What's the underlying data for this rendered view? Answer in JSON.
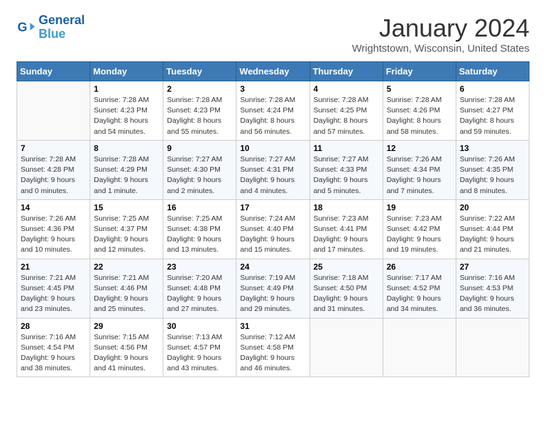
{
  "header": {
    "logo_line1": "General",
    "logo_line2": "Blue",
    "month_title": "January 2024",
    "location": "Wrightstown, Wisconsin, United States"
  },
  "days_of_week": [
    "Sunday",
    "Monday",
    "Tuesday",
    "Wednesday",
    "Thursday",
    "Friday",
    "Saturday"
  ],
  "weeks": [
    [
      {
        "day": "",
        "info": ""
      },
      {
        "day": "1",
        "info": "Sunrise: 7:28 AM\nSunset: 4:23 PM\nDaylight: 8 hours\nand 54 minutes."
      },
      {
        "day": "2",
        "info": "Sunrise: 7:28 AM\nSunset: 4:23 PM\nDaylight: 8 hours\nand 55 minutes."
      },
      {
        "day": "3",
        "info": "Sunrise: 7:28 AM\nSunset: 4:24 PM\nDaylight: 8 hours\nand 56 minutes."
      },
      {
        "day": "4",
        "info": "Sunrise: 7:28 AM\nSunset: 4:25 PM\nDaylight: 8 hours\nand 57 minutes."
      },
      {
        "day": "5",
        "info": "Sunrise: 7:28 AM\nSunset: 4:26 PM\nDaylight: 8 hours\nand 58 minutes."
      },
      {
        "day": "6",
        "info": "Sunrise: 7:28 AM\nSunset: 4:27 PM\nDaylight: 8 hours\nand 59 minutes."
      }
    ],
    [
      {
        "day": "7",
        "info": "Sunrise: 7:28 AM\nSunset: 4:28 PM\nDaylight: 9 hours\nand 0 minutes."
      },
      {
        "day": "8",
        "info": "Sunrise: 7:28 AM\nSunset: 4:29 PM\nDaylight: 9 hours\nand 1 minute."
      },
      {
        "day": "9",
        "info": "Sunrise: 7:27 AM\nSunset: 4:30 PM\nDaylight: 9 hours\nand 2 minutes."
      },
      {
        "day": "10",
        "info": "Sunrise: 7:27 AM\nSunset: 4:31 PM\nDaylight: 9 hours\nand 4 minutes."
      },
      {
        "day": "11",
        "info": "Sunrise: 7:27 AM\nSunset: 4:33 PM\nDaylight: 9 hours\nand 5 minutes."
      },
      {
        "day": "12",
        "info": "Sunrise: 7:26 AM\nSunset: 4:34 PM\nDaylight: 9 hours\nand 7 minutes."
      },
      {
        "day": "13",
        "info": "Sunrise: 7:26 AM\nSunset: 4:35 PM\nDaylight: 9 hours\nand 8 minutes."
      }
    ],
    [
      {
        "day": "14",
        "info": "Sunrise: 7:26 AM\nSunset: 4:36 PM\nDaylight: 9 hours\nand 10 minutes."
      },
      {
        "day": "15",
        "info": "Sunrise: 7:25 AM\nSunset: 4:37 PM\nDaylight: 9 hours\nand 12 minutes."
      },
      {
        "day": "16",
        "info": "Sunrise: 7:25 AM\nSunset: 4:38 PM\nDaylight: 9 hours\nand 13 minutes."
      },
      {
        "day": "17",
        "info": "Sunrise: 7:24 AM\nSunset: 4:40 PM\nDaylight: 9 hours\nand 15 minutes."
      },
      {
        "day": "18",
        "info": "Sunrise: 7:23 AM\nSunset: 4:41 PM\nDaylight: 9 hours\nand 17 minutes."
      },
      {
        "day": "19",
        "info": "Sunrise: 7:23 AM\nSunset: 4:42 PM\nDaylight: 9 hours\nand 19 minutes."
      },
      {
        "day": "20",
        "info": "Sunrise: 7:22 AM\nSunset: 4:44 PM\nDaylight: 9 hours\nand 21 minutes."
      }
    ],
    [
      {
        "day": "21",
        "info": "Sunrise: 7:21 AM\nSunset: 4:45 PM\nDaylight: 9 hours\nand 23 minutes."
      },
      {
        "day": "22",
        "info": "Sunrise: 7:21 AM\nSunset: 4:46 PM\nDaylight: 9 hours\nand 25 minutes."
      },
      {
        "day": "23",
        "info": "Sunrise: 7:20 AM\nSunset: 4:48 PM\nDaylight: 9 hours\nand 27 minutes."
      },
      {
        "day": "24",
        "info": "Sunrise: 7:19 AM\nSunset: 4:49 PM\nDaylight: 9 hours\nand 29 minutes."
      },
      {
        "day": "25",
        "info": "Sunrise: 7:18 AM\nSunset: 4:50 PM\nDaylight: 9 hours\nand 31 minutes."
      },
      {
        "day": "26",
        "info": "Sunrise: 7:17 AM\nSunset: 4:52 PM\nDaylight: 9 hours\nand 34 minutes."
      },
      {
        "day": "27",
        "info": "Sunrise: 7:16 AM\nSunset: 4:53 PM\nDaylight: 9 hours\nand 36 minutes."
      }
    ],
    [
      {
        "day": "28",
        "info": "Sunrise: 7:16 AM\nSunset: 4:54 PM\nDaylight: 9 hours\nand 38 minutes."
      },
      {
        "day": "29",
        "info": "Sunrise: 7:15 AM\nSunset: 4:56 PM\nDaylight: 9 hours\nand 41 minutes."
      },
      {
        "day": "30",
        "info": "Sunrise: 7:13 AM\nSunset: 4:57 PM\nDaylight: 9 hours\nand 43 minutes."
      },
      {
        "day": "31",
        "info": "Sunrise: 7:12 AM\nSunset: 4:58 PM\nDaylight: 9 hours\nand 46 minutes."
      },
      {
        "day": "",
        "info": ""
      },
      {
        "day": "",
        "info": ""
      },
      {
        "day": "",
        "info": ""
      }
    ]
  ]
}
